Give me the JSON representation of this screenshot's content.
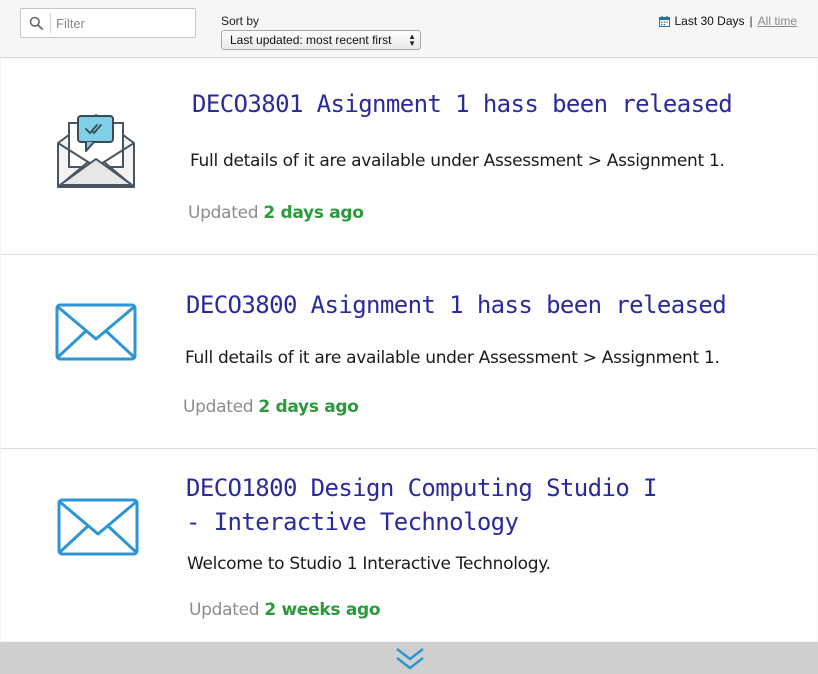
{
  "toolbar": {
    "filter_placeholder": "Filter",
    "sort_label": "Sort by",
    "sort_selected": "Last updated: most recent first",
    "range_active": "Last 30 Days",
    "range_separator": "|",
    "range_all": "All time"
  },
  "notifications": [
    {
      "title": "DECO3801 Asignment 1 hass been released",
      "body": "Full details of it are available under Assessment > Assignment 1.",
      "updated_prefix": "Updated",
      "updated_ago": "2 days ago",
      "icon": "open-envelope-message-icon"
    },
    {
      "title": "DECO3800 Asignment 1 hass been released",
      "body": "Full details of it are available under Assessment > Assignment 1.",
      "updated_prefix": "Updated",
      "updated_ago": "2 days ago",
      "icon": "envelope-icon"
    },
    {
      "title": "DECO1800 Design Computing Studio I\n- Interactive Technology",
      "body": "Welcome to Studio 1 Interactive Technology.",
      "updated_prefix": "Updated",
      "updated_ago": "2 weeks ago",
      "icon": "envelope-icon"
    }
  ],
  "colors": {
    "title": "#2b2a9a",
    "ago": "#2a9a3a",
    "envelope": "#2e95d3",
    "muted": "#8c8c8c"
  }
}
